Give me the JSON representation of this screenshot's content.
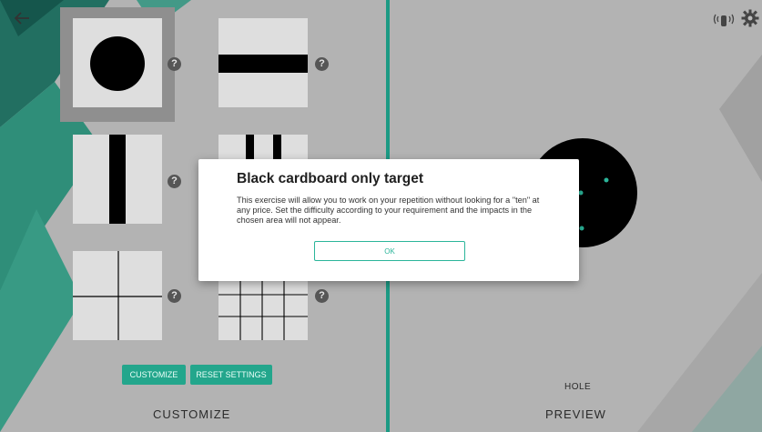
{
  "topbar": {
    "back_icon": "arrow-left-icon",
    "settings_icon": "gear-icon",
    "connect_icon": "wireless-hand-icon"
  },
  "left_panel": {
    "targets": [
      {
        "name": "black-disc",
        "help": "?"
      },
      {
        "name": "horizontal-bar",
        "help": "?"
      },
      {
        "name": "vertical-bar",
        "help": "?"
      },
      {
        "name": "double-vertical-bars",
        "help": "?"
      },
      {
        "name": "cross-lines",
        "help": "?"
      },
      {
        "name": "grid-lines",
        "help": "?"
      }
    ],
    "customize_button": "CUSTOMIZE",
    "reset_button": "RESET SETTINGS",
    "footer_label": "CUSTOMIZE"
  },
  "right_panel": {
    "hole_label": "HOLE",
    "footer_label": "PREVIEW"
  },
  "modal": {
    "title": "Black cardboard only target",
    "body": "This exercise will allow you to work on your repetition without looking for a \"ten\" at any price. Set the difficulty according to your requirement and the impacts in the chosen area will not appear.",
    "ok": "OK"
  },
  "colors": {
    "accent": "#1c9a84",
    "button": "#23a68c"
  }
}
